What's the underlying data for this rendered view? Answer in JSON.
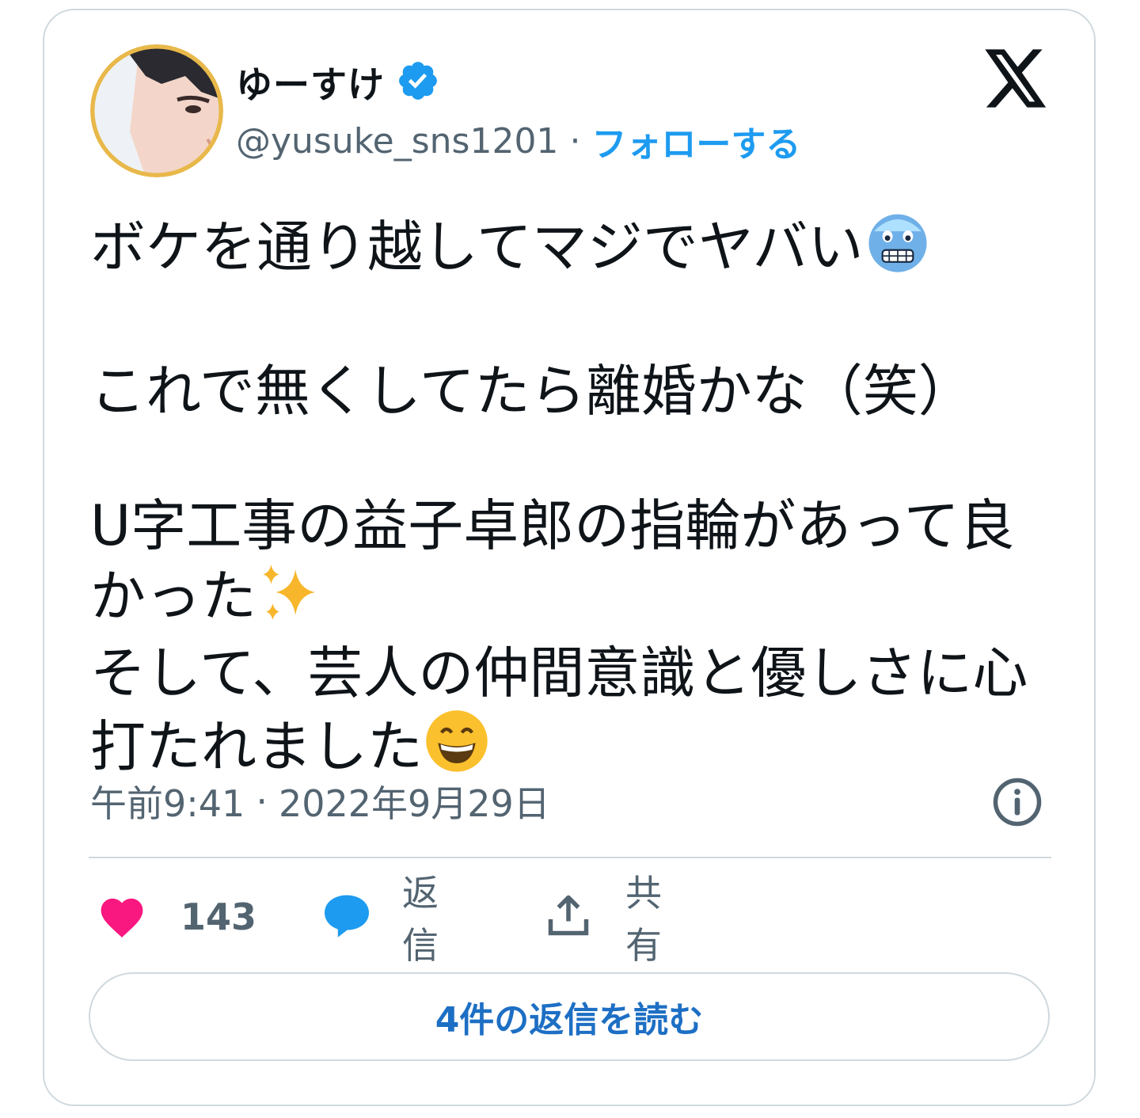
{
  "tweet": {
    "author": {
      "display_name": "ゆーすけ",
      "verified": true,
      "handle": "@yusuke_sns1201",
      "separator": "·",
      "follow_label": "フォローする"
    },
    "body_paragraphs": [
      "ボケを通り越してマジでヤバい",
      "これで無くしてたら離婚かな（笑）",
      "U字工事の益子卓郎の指輪があって良かった",
      "そして、芸人の仲間意識と優しさに心打たれました"
    ],
    "time": "午前9:41",
    "meta_separator": "·",
    "date": "2022年9月29日",
    "actions": {
      "like_count": "143",
      "reply_label": "返信",
      "share_label": "共有"
    },
    "read_replies_label": "4件の返信を読む"
  },
  "icons": [
    "verified-badge-icon",
    "x-logo-icon",
    "info-icon",
    "heart-icon",
    "reply-bubble-icon",
    "share-icon",
    "cold-face-emoji",
    "sparkles-emoji",
    "grinning-face-emoji"
  ],
  "colors": {
    "accent": "#1d9bf0",
    "heart": "#f91880",
    "text_secondary": "#536471",
    "border": "#cfd9de"
  }
}
